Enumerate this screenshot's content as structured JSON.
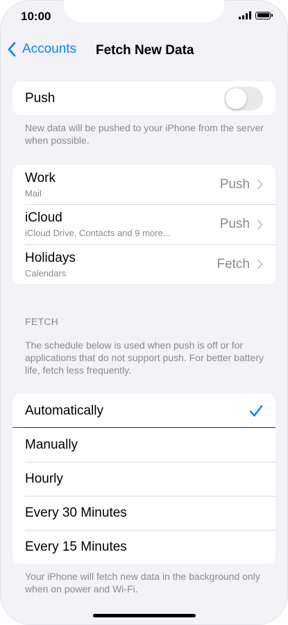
{
  "status": {
    "time": "10:00"
  },
  "nav": {
    "back_label": "Accounts",
    "title": "Fetch New Data"
  },
  "push": {
    "label": "Push",
    "enabled": false,
    "note": "New data will be pushed to your iPhone from the server when possible."
  },
  "accounts": [
    {
      "title": "Work",
      "subtitle": "Mail",
      "value": "Push"
    },
    {
      "title": "iCloud",
      "subtitle": "iCloud Drive, Contacts and 9 more...",
      "value": "Push"
    },
    {
      "title": "Holidays",
      "subtitle": "Calendars",
      "value": "Fetch"
    }
  ],
  "fetch": {
    "header": "FETCH",
    "note": "The schedule below is used when push is off or for applications that do not support push. For better battery life, fetch less frequently.",
    "options": [
      {
        "label": "Automatically",
        "selected": true
      },
      {
        "label": "Manually",
        "selected": false
      },
      {
        "label": "Hourly",
        "selected": false
      },
      {
        "label": "Every 30 Minutes",
        "selected": false
      },
      {
        "label": "Every 15 Minutes",
        "selected": false
      }
    ],
    "footer": "Your iPhone will fetch new data in the background only when on power and Wi-Fi."
  },
  "colors": {
    "accent": "#0A84FF",
    "background": "#F2F2F7",
    "secondary_text": "#8A8A8E",
    "toggle_off": "#E9E9EA"
  }
}
